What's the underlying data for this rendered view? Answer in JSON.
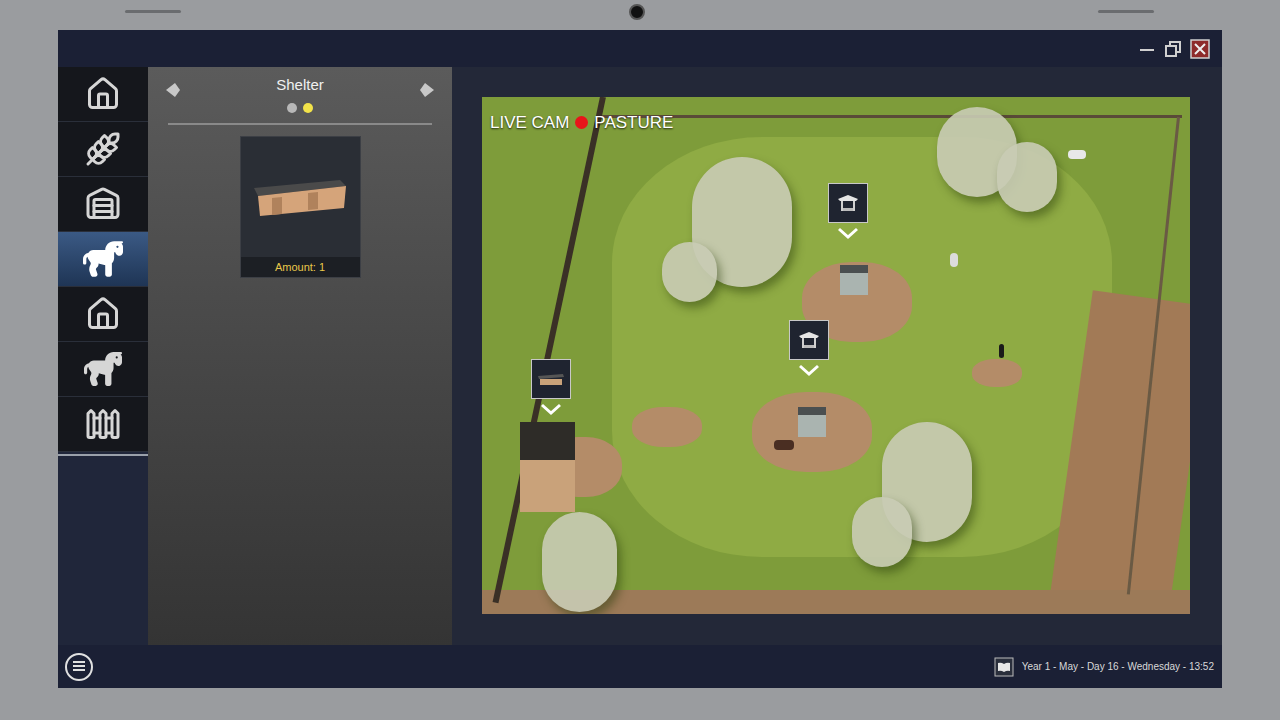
{
  "window": {
    "controls": {
      "minimize": true,
      "maximize": true,
      "close": true
    }
  },
  "sidebar": {
    "items": [
      {
        "selected": false
      },
      {
        "selected": false
      },
      {
        "selected": false
      },
      {
        "selected": true
      },
      {
        "selected": false
      },
      {
        "selected": false
      },
      {
        "selected": false
      }
    ]
  },
  "panel": {
    "title": "Shelter",
    "pages": [
      {
        "selected": false
      },
      {
        "selected": true
      }
    ],
    "items": [
      {
        "amount": "Amount: 1"
      }
    ]
  },
  "camera": {
    "live_label": "LIVE CAM",
    "recording": true,
    "location": "PASTURE",
    "markers": [
      {
        "kind": "small"
      },
      {
        "kind": "small"
      },
      {
        "kind": "long"
      }
    ]
  },
  "status_bar": {
    "date": "Year 1 - May - Day 16 - Wednesday - 13:52"
  }
}
